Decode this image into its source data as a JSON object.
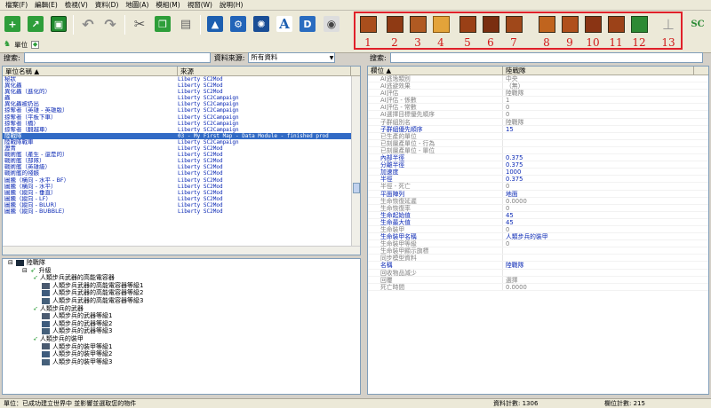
{
  "menu": [
    "檔案(F)",
    "編輯(E)",
    "檢視(V)",
    "資料(D)",
    "地圖(A)",
    "模組(M)",
    "視窗(W)",
    "說明(H)"
  ],
  "toolbar": {
    "highlight_numbers": [
      "1",
      "2",
      "3",
      "4",
      "5",
      "6",
      "7",
      "8",
      "9",
      "10",
      "11",
      "12",
      "13"
    ],
    "text_icon": "A",
    "doc_icon": "D",
    "sc_logo": "SC"
  },
  "tab": {
    "label": "單位"
  },
  "left_search": {
    "label": "搜索:",
    "source_label": "資料來源:",
    "source_value": "所有資料"
  },
  "right_search": {
    "label": "搜索:"
  },
  "unit_list": {
    "columns": [
      "單位名稱",
      "來源"
    ],
    "rows": [
      {
        "name": "秘狀",
        "source": "Liberty SC2Mod"
      },
      {
        "name": "異化蟲",
        "source": "Liberty SC2Mod"
      },
      {
        "name": "異化蟲（進化的）",
        "source": "Liberty SC2Mod"
      },
      {
        "name": "蟲",
        "source": "Liberty SC2Campaign"
      },
      {
        "name": "異化蟲被扔出",
        "source": "Liberty SC2Campaign"
      },
      {
        "name": "掠奪者（英雄 - 英雄版）",
        "source": "Liberty SC2Campaign"
      },
      {
        "name": "掠奪者（平板下車）",
        "source": "Liberty SC2Campaign"
      },
      {
        "name": "掠奪者（橋）",
        "source": "Liberty SC2Campaign"
      },
      {
        "name": "掠奪者（翻越車）",
        "source": "Liberty SC2Campaign"
      },
      {
        "name": "陸戰隊",
        "source": "03 - My First Map - Data Module - finished prod"
      },
      {
        "name": "陸戰隊戰車",
        "source": "Liberty SC2Campaign"
      },
      {
        "name": "瀝青",
        "source": "Liberty SC2Mod"
      },
      {
        "name": "戰術艦（產生 - 還是的）",
        "source": "Liberty SC2Mod"
      },
      {
        "name": "戰術艦（部隊）",
        "source": "Liberty SC2Mod"
      },
      {
        "name": "戰術艦（英雄級）",
        "source": "Liberty SC2Mod"
      },
      {
        "name": "戰術艦的殘骸",
        "source": "Liberty SC2Mod"
      },
      {
        "name": "圖騰（橫向 - 水平 - BF）",
        "source": "Liberty SC2Mod"
      },
      {
        "name": "圖騰（橫向 - 水平）",
        "source": "Liberty SC2Mod"
      },
      {
        "name": "圖騰（縱向 - 垂直）",
        "source": "Liberty SC2Mod"
      },
      {
        "name": "圖騰（縱向 - LF）",
        "source": "Liberty SC2Mod"
      },
      {
        "name": "圖騰（縱向 - BLUR）",
        "source": "Liberty SC2Mod"
      },
      {
        "name": "圖騰（縱向 - BUBBLE）",
        "source": "Liberty SC2Mod"
      }
    ]
  },
  "tree": {
    "root": "陸戰隊",
    "group": "升級",
    "items": [
      "人類步兵武器的高能電容器",
      "人類步兵武器的高能電容器等級1",
      "人類步兵武器的高能電容器等級2",
      "人類步兵武器的高能電容器等級3",
      "人類步兵的武器",
      "人類步兵的武器等級1",
      "人類步兵的武器等級2",
      "人類步兵的武器等級3",
      "人類步兵的裝甲",
      "人類步兵的裝甲等級1",
      "人類步兵的裝甲等級2",
      "人類步兵的裝甲等級3"
    ]
  },
  "properties": {
    "columns": [
      "欄位",
      "陸戰隊"
    ],
    "rows": [
      {
        "key": "AI逃逸類別",
        "value": "中央",
        "set": false
      },
      {
        "key": "AI逃避效果",
        "value": "（無）",
        "set": false
      },
      {
        "key": "AI評估",
        "value": "陸戰隊",
        "set": false
      },
      {
        "key": "AI評估 - 係數",
        "value": "1",
        "set": false
      },
      {
        "key": "AI評估 - 常數",
        "value": "0",
        "set": false
      },
      {
        "key": "AI選擇目標優先順序",
        "value": "0",
        "set": false
      },
      {
        "key": "子群組別名",
        "value": "陸戰隊",
        "set": false
      },
      {
        "key": "子群組優先順序",
        "value": "15",
        "set": true
      },
      {
        "key": "已生產的單位",
        "value": "",
        "set": false
      },
      {
        "key": "已刻層產單位 - 行為",
        "value": "",
        "set": false
      },
      {
        "key": "已刻層產單位 - 單位",
        "value": "",
        "set": false
      },
      {
        "key": "內部半徑",
        "value": "0.375",
        "set": true
      },
      {
        "key": "分離半徑",
        "value": "0.375",
        "set": true
      },
      {
        "key": "加速度",
        "value": "1000",
        "set": true
      },
      {
        "key": "半徑",
        "value": "0.375",
        "set": true
      },
      {
        "key": "半徑 - 死亡",
        "value": "0",
        "set": false
      },
      {
        "key": "平面陣列",
        "value": "地面",
        "set": true
      },
      {
        "key": "生命恢復延遲",
        "value": "0.0000",
        "set": false
      },
      {
        "key": "生命恢復率",
        "value": "0",
        "set": false
      },
      {
        "key": "生命起始值",
        "value": "45",
        "set": true
      },
      {
        "key": "生命最大值",
        "value": "45",
        "set": true
      },
      {
        "key": "生命裝甲",
        "value": "0",
        "set": false
      },
      {
        "key": "生命裝甲名稱",
        "value": "人類步兵的裝甲",
        "set": true
      },
      {
        "key": "生命裝甲等級",
        "value": "0",
        "set": false
      },
      {
        "key": "生命裝甲顯示旗標",
        "value": "",
        "set": false
      },
      {
        "key": "同步模型資料",
        "value": "",
        "set": false
      },
      {
        "key": "名稱",
        "value": "陸戰隊",
        "set": true
      },
      {
        "key": "回收物品減少",
        "value": "",
        "set": false
      },
      {
        "key": "回覆",
        "value": "選擇",
        "set": false
      },
      {
        "key": "死亡時間",
        "value": "0.0000",
        "set": false
      }
    ]
  },
  "status": {
    "message": "單位：已成功建立世界中 並影響並選取您的物件",
    "data_count": "資料計數: 1306",
    "field_count": "欄位計數: 215"
  }
}
